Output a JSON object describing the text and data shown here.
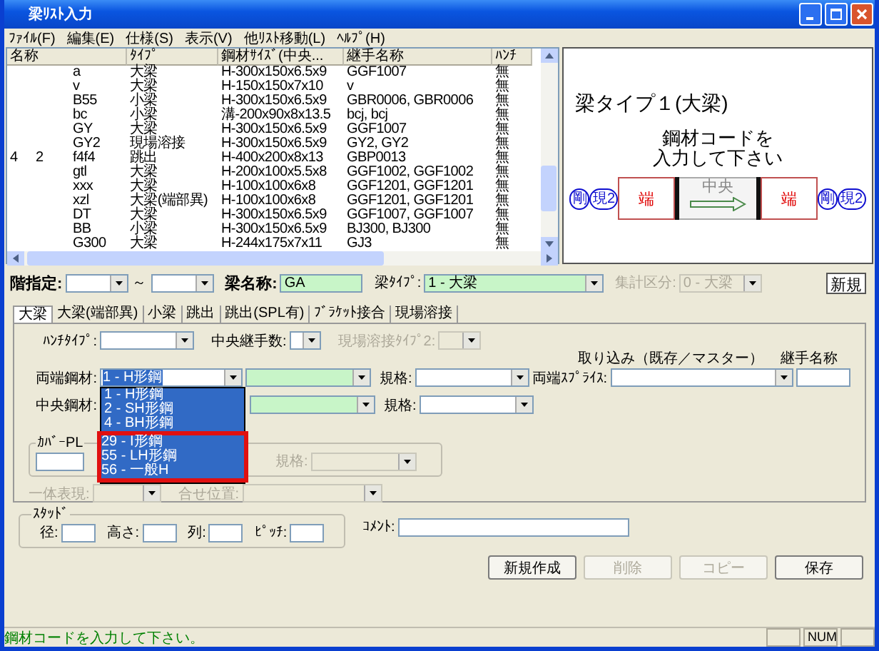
{
  "window": {
    "title": "梁ﾘｽﾄ入力"
  },
  "menu": [
    "ﾌｧｲﾙ(F)",
    "編集(E)",
    "仕様(S)",
    "表示(V)",
    "他ﾘｽﾄ移動(L)",
    "ﾍﾙﾌﾟ(H)"
  ],
  "list": {
    "columns": [
      "名称",
      "ﾀｲﾌﾟ",
      "鋼材ｻｲｽﾞ(中央...",
      "継手名称",
      "ﾊﾝﾁ"
    ],
    "rows": [
      {
        "name": "a",
        "type": "大梁",
        "size": "H-300x150x6.5x9",
        "joint": "GGF1007",
        "haunch": "無"
      },
      {
        "name": "v",
        "type": "大梁",
        "size": "H-150x150x7x10",
        "joint": "v",
        "haunch": "無"
      },
      {
        "name": "B55",
        "type": "小梁",
        "size": "H-300x150x6.5x9",
        "joint": "GBR0006, GBR0006",
        "haunch": "無"
      },
      {
        "name": "bc",
        "type": "小梁",
        "size": "溝-200x90x8x13.5",
        "joint": "bcj, bcj",
        "haunch": "無"
      },
      {
        "name": "GY",
        "type": "大梁",
        "size": "H-300x150x6.5x9",
        "joint": "GGF1007",
        "haunch": "無"
      },
      {
        "name": "GY2",
        "type": "現場溶接",
        "size": "H-300x150x6.5x9",
        "joint": "GY2, GY2",
        "haunch": "無"
      },
      {
        "column_1": "4",
        "column_2": "2",
        "name": "f4f4",
        "type": "跳出",
        "size": "H-400x200x8x13",
        "joint": "GBP0013",
        "haunch": "無"
      },
      {
        "name": "gtl",
        "type": "大梁",
        "size": "H-200x100x5.5x8",
        "joint": "GGF1002, GGF1002",
        "haunch": "無"
      },
      {
        "name": "xxx",
        "type": "大梁",
        "size": "H-100x100x6x8",
        "joint": "GGF1201, GGF1201",
        "haunch": "無"
      },
      {
        "name": "xzl",
        "type": "大梁(端部異)",
        "size": "H-100x100x6x8",
        "joint": "GGF1201, GGF1201",
        "haunch": "無"
      },
      {
        "name": "DT",
        "type": "大梁",
        "size": "H-300x150x6.5x9",
        "joint": "GGF1007, GGF1007",
        "haunch": "無"
      },
      {
        "name": "BB",
        "type": "小梁",
        "size": "H-300x150x6.5x9",
        "joint": "BJ300, BJ300",
        "haunch": "無"
      },
      {
        "name": "G300",
        "type": "大梁",
        "size": "H-244x175x7x11",
        "joint": "GJ3",
        "haunch": "無"
      }
    ]
  },
  "preview": {
    "title": "梁タイプ１(大梁)",
    "message": [
      "鋼材コードを",
      "入力して下さい"
    ],
    "left_marks": [
      "剛",
      "現2"
    ],
    "left_end": "端",
    "center": "中央",
    "right_end": "端",
    "right_marks": [
      "剛",
      "現2"
    ]
  },
  "top": {
    "floor_label": "階指定:",
    "range_sep": "～",
    "name_label": "梁名称:",
    "name_value": "GA",
    "type_label": "梁ﾀｲﾌﾟ:",
    "type_value": "1 - 大梁",
    "total_label": "集計区分:",
    "total_value": "0 - 大梁",
    "total_disabled": true,
    "new_button": "新規"
  },
  "tabs": [
    {
      "label": "大梁",
      "selected": true
    },
    {
      "label": "大梁(端部異)",
      "selected": false
    },
    {
      "label": "小梁",
      "selected": false
    },
    {
      "label": "跳出",
      "selected": false
    },
    {
      "label": "跳出(SPL有)",
      "selected": false
    },
    {
      "label": "ﾌﾞﾗｹｯﾄ接合",
      "selected": false
    },
    {
      "label": "現場溶接",
      "selected": false
    }
  ],
  "panel": {
    "haunch_label": "ﾊﾝﾁﾀｲﾌﾟ:",
    "joints_label": "中央継手数:",
    "weld": {
      "label": "現場溶接ﾀｲﾌﾟ2:",
      "disabled": true
    },
    "import_label": "取り込み（既存／マスター）",
    "joint_name_label": "継手名称",
    "end_steel_label": "両端鋼材:",
    "end_steel_value": "1 - H形鋼",
    "end_spec_label": "規格:",
    "splice_label": "両端ｽﾌﾟﾗｲｽ:",
    "center_steel_label": "中央鋼材:",
    "center_spec_label": "規格:",
    "dropdown": [
      {
        "label": "1 - H形鋼",
        "highlighted": false
      },
      {
        "label": "2 - SH形鋼",
        "highlighted": false
      },
      {
        "label": "4 - BH形鋼",
        "highlighted": false
      },
      {
        "label": "29 - I形鋼",
        "highlighted": true
      },
      {
        "label": "55 - LH形鋼",
        "highlighted": true
      },
      {
        "label": "56 - 一般H",
        "highlighted": true
      }
    ],
    "cover": {
      "title": "ｶﾊﾞｰPL",
      "spec": {
        "label": "規格:",
        "disabled": true
      }
    },
    "unified": {
      "label": "一体表現:",
      "disabled": true
    },
    "align": {
      "label": "合せ位置:",
      "disabled": true
    }
  },
  "stud": {
    "title": "ｽﾀｯﾄﾞ",
    "fields": [
      "径:",
      "高さ:",
      "列:",
      "ﾋﾟｯﾁ:"
    ],
    "comment_label": "ｺﾒﾝﾄ:"
  },
  "buttons": [
    {
      "label": "新規作成",
      "disabled": false
    },
    {
      "label": "削除",
      "disabled": true
    },
    {
      "label": "コピー",
      "disabled": true
    },
    {
      "label": "保存",
      "disabled": false
    }
  ],
  "status": {
    "message": "鋼材コードを入力して下さい。",
    "panes": [
      "NUM"
    ]
  }
}
